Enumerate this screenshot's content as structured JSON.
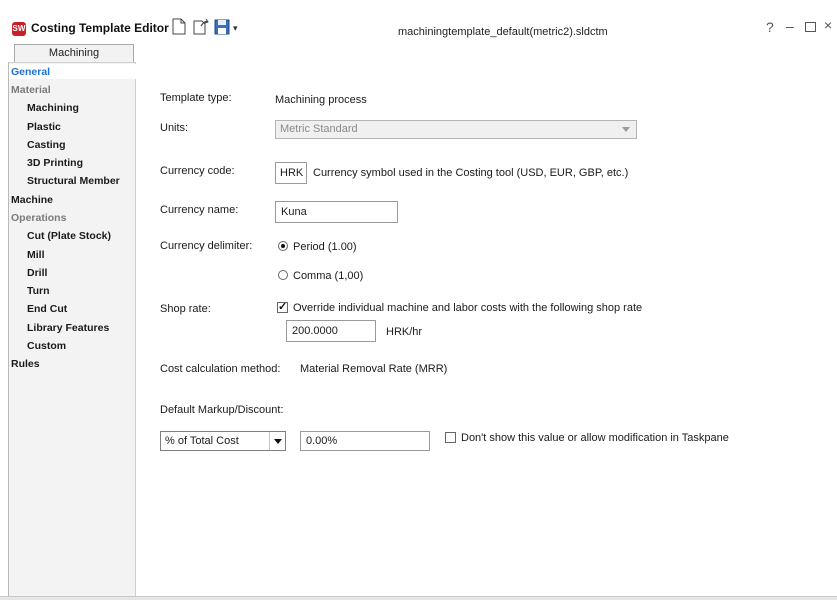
{
  "app": {
    "title": "Costing Template Editor",
    "logo_text": "SW",
    "document_title": "machiningtemplate_default(metric2).sldctm",
    "help_glyph": "?",
    "minimize_glyph": "–",
    "close_glyph": "×"
  },
  "toolbar": {
    "dropdown_glyph": "▾"
  },
  "tab": {
    "label": "Machining"
  },
  "sidebar": {
    "items": [
      {
        "label": "General",
        "kind": "active"
      },
      {
        "label": "Material",
        "kind": "group"
      },
      {
        "label": "Machining",
        "kind": "sub"
      },
      {
        "label": "Plastic",
        "kind": "sub"
      },
      {
        "label": "Casting",
        "kind": "sub"
      },
      {
        "label": "3D Printing",
        "kind": "sub"
      },
      {
        "label": "Structural Member",
        "kind": "sub"
      },
      {
        "label": "Machine",
        "kind": "top"
      },
      {
        "label": "Operations",
        "kind": "group"
      },
      {
        "label": "Cut (Plate Stock)",
        "kind": "sub"
      },
      {
        "label": "Mill",
        "kind": "sub"
      },
      {
        "label": "Drill",
        "kind": "sub"
      },
      {
        "label": "Turn",
        "kind": "sub"
      },
      {
        "label": "End Cut",
        "kind": "sub"
      },
      {
        "label": "Library Features",
        "kind": "sub"
      },
      {
        "label": "Custom",
        "kind": "sub"
      },
      {
        "label": "Rules",
        "kind": "top"
      }
    ]
  },
  "form": {
    "template_type_label": "Template type:",
    "template_type_value": "Machining process",
    "units_label": "Units:",
    "units_value": "Metric Standard",
    "currency_code_label": "Currency code:",
    "currency_code_value": "HRK",
    "currency_code_hint": "Currency symbol used in the Costing tool (USD, EUR, GBP, etc.)",
    "currency_name_label": "Currency name:",
    "currency_name_value": "Kuna",
    "currency_delimiter_label": "Currency delimiter:",
    "delimiter_period_label": "Period   (1.00)",
    "delimiter_comma_label": "Comma (1,00)",
    "shop_rate_label": "Shop rate:",
    "shop_rate_override_label": "Override individual machine and labor costs with the following shop rate",
    "shop_rate_value": "200.0000",
    "shop_rate_unit": "HRK/hr",
    "cost_method_label": "Cost calculation method:",
    "cost_method_value": "Material Removal Rate (MRR)",
    "markup_label": "Default Markup/Discount:",
    "markup_type_value": "% of Total Cost",
    "markup_value": "0.00%",
    "markup_hide_label": "Don't show this value or allow modification in Taskpane"
  }
}
